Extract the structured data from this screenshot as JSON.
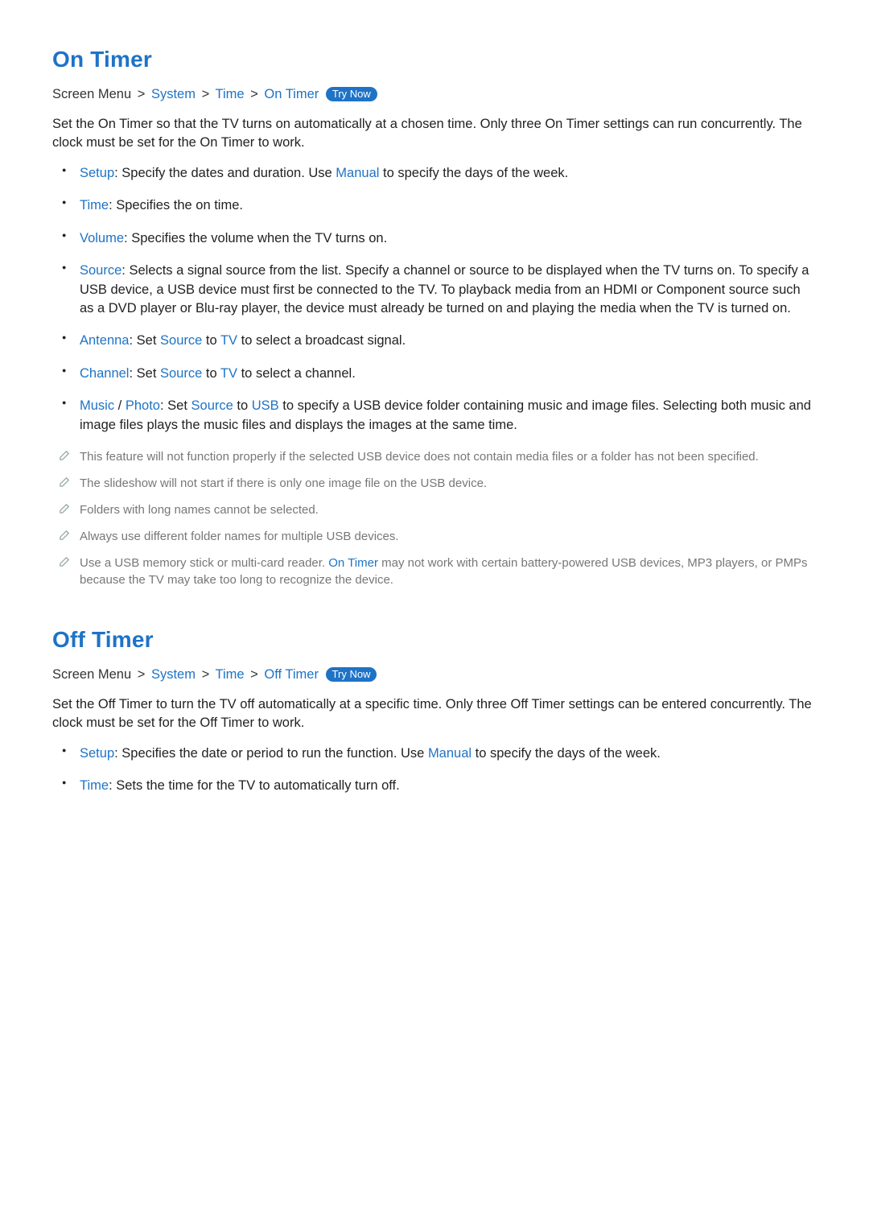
{
  "sections": [
    {
      "title": "On Timer",
      "breadcrumb": {
        "prefix": "Screen Menu",
        "path": [
          "System",
          "Time",
          "On Timer"
        ],
        "try_now": "Try Now"
      },
      "intro": "Set the On Timer so that the TV turns on automatically at a chosen time. Only three On Timer settings can run concurrently. The clock must be set for the On Timer to work.",
      "bullets": [
        {
          "kw": "Setup",
          "text_before": ": Specify the dates and duration. Use ",
          "kw2": "Manual",
          "text_after": " to specify the days of the week."
        },
        {
          "kw": "Time",
          "text_before": ": Specifies the on time."
        },
        {
          "kw": "Volume",
          "text_before": ": Specifies the volume when the TV turns on."
        },
        {
          "kw": "Source",
          "text_before": ": Selects a signal source from the list. Specify a channel or source to be displayed when the TV turns on. To specify a USB device, a USB device must first be connected to the TV. To playback media from an HDMI or Component source such as a DVD player or Blu-ray player, the device must already be turned on and playing the media when the TV is turned on."
        },
        {
          "kw": "Antenna",
          "text_before": ": Set ",
          "kw2": "Source",
          "text_mid": " to ",
          "kw3": "TV",
          "text_after": " to select a broadcast signal."
        },
        {
          "kw": "Channel",
          "text_before": ": Set ",
          "kw2": "Source",
          "text_mid": " to ",
          "kw3": "TV",
          "text_after": " to select a channel."
        },
        {
          "kw": "Music",
          "kw_sep": " / ",
          "kw_b": "Photo",
          "text_before": ": Set ",
          "kw2": "Source",
          "text_mid": " to ",
          "kw3": "USB",
          "text_after": " to specify a USB device folder containing music and image files. Selecting both music and image files plays the music files and displays the images at the same time."
        }
      ],
      "notes": [
        {
          "text": "This feature will not function properly if the selected USB device does not contain media files or a folder has not been specified."
        },
        {
          "text": "The slideshow will not start if there is only one image file on the USB device."
        },
        {
          "text": "Folders with long names cannot be selected."
        },
        {
          "text": "Always use different folder names for multiple USB devices."
        },
        {
          "text_before": "Use a USB memory stick or multi-card reader. ",
          "kw": "On Timer",
          "text_after": " may not work with certain battery-powered USB devices, MP3 players, or PMPs because the TV may take too long to recognize the device."
        }
      ]
    },
    {
      "title": "Off Timer",
      "breadcrumb": {
        "prefix": "Screen Menu",
        "path": [
          "System",
          "Time",
          "Off Timer"
        ],
        "try_now": "Try Now"
      },
      "intro": "Set the Off Timer to turn the TV off automatically at a specific time. Only three Off Timer settings can be entered concurrently. The clock must be set for the Off Timer to work.",
      "bullets": [
        {
          "kw": "Setup",
          "text_before": ": Specifies the date or period to run the function. Use ",
          "kw2": "Manual",
          "text_after": " to specify the days of the week."
        },
        {
          "kw": "Time",
          "text_before": ": Sets the time for the TV to automatically turn off."
        }
      ],
      "notes": []
    }
  ],
  "sep_glyph": ">"
}
